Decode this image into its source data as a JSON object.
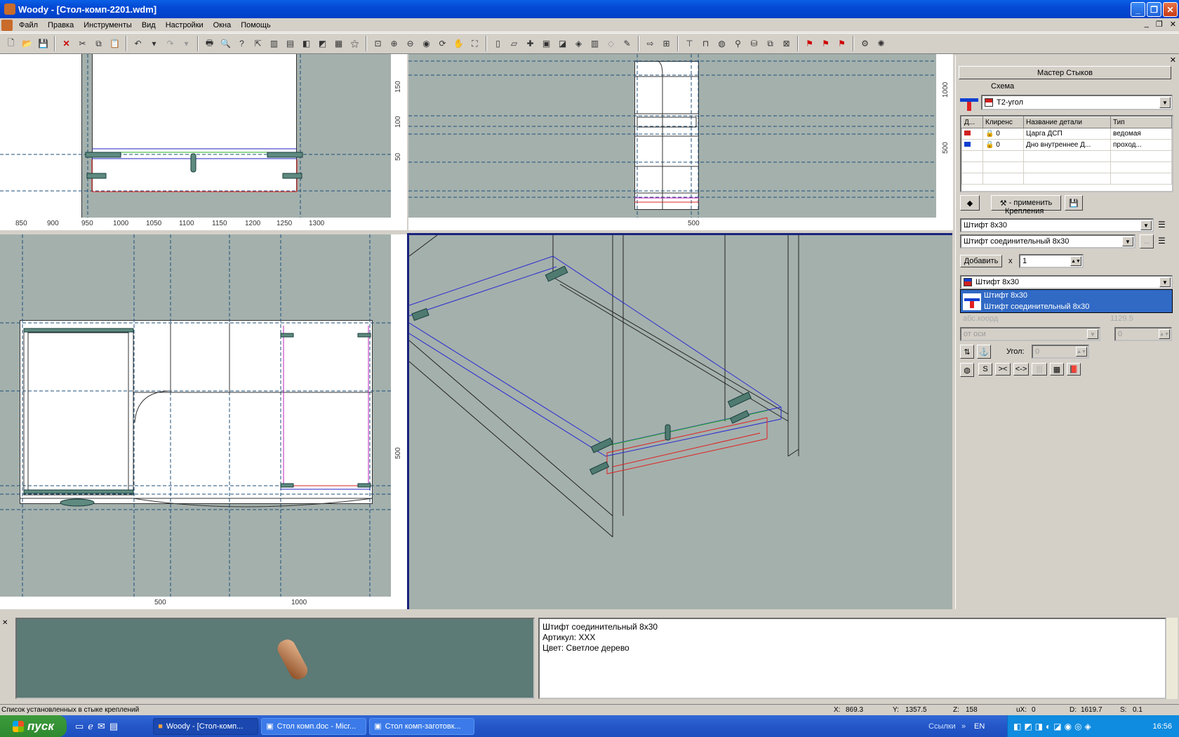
{
  "window": {
    "title": "Woody - [Стол-комп-2201.wdm]"
  },
  "menu": [
    "Файл",
    "Правка",
    "Инструменты",
    "Вид",
    "Настройки",
    "Окна",
    "Помощь"
  ],
  "viewports": {
    "front_ruler_ticks": [
      "850",
      "900",
      "950",
      "1000",
      "1050",
      "1100",
      "1150",
      "1200",
      "1250",
      "1300"
    ],
    "front_vruler_ticks": [
      "150",
      "100",
      "50"
    ],
    "side_ruler_ticks": [
      "500"
    ],
    "side_vruler_ticks": [
      "1000",
      "500"
    ],
    "top_ruler_ticks": [
      "500",
      "1000"
    ],
    "top_vruler_ticks": [
      "500"
    ]
  },
  "panel": {
    "title": "Мастер Стыков",
    "schema_label": "Схема",
    "schema_value": "Т2-угол",
    "table_headers": [
      "Д...",
      "Клиренс",
      "Название детали",
      "Тип"
    ],
    "table_rows": [
      {
        "clearance": "0",
        "name": "Царга ДСП",
        "type": "ведомая"
      },
      {
        "clearance": "0",
        "name": "Дно внутреннее Д...",
        "type": "проход..."
      }
    ],
    "apply_label": "- применить",
    "fastenings_label": "Крепления",
    "fastener1": "Штифт 8х30",
    "fastener2": "Штифт соединительный 8х30",
    "add_label": "Добавить",
    "x_label": "x",
    "qty": "1",
    "selected_fastener": "Штифт 8х30",
    "dropdown_options": [
      "Штифт 8х30",
      "Штифт соединительный 8х30"
    ],
    "coord_placeholder": "абс.коорд",
    "coord_value": "1129.5",
    "from_axis": "от оси",
    "from_axis_value": "0",
    "angle_label": "Угол:",
    "angle_value": "0",
    "btn_s": "S",
    "btn_in": "><",
    "btn_out": "<->"
  },
  "info": {
    "name": "Штифт соединительный 8х30",
    "article": "Артикул: XXX",
    "color": "Цвет: Светлое дерево"
  },
  "status": {
    "text": "Список установленных в стыке креплений",
    "x_label": "X:",
    "x": "869.3",
    "y_label": "Y:",
    "y": "1357.5",
    "z_label": "Z:",
    "z": "158",
    "ux_label": "uX:",
    "ux": "0",
    "d_label": "D:",
    "d": "1619.7",
    "s_label": "S:",
    "s": "0.1"
  },
  "taskbar": {
    "start": "пуск",
    "tasks": [
      "Woody - [Стол-комп...",
      "Стол комп.doc - Micr...",
      "Стол комп-заготовк..."
    ],
    "links": "Ссылки",
    "lang": "EN",
    "clock": "16:56"
  }
}
